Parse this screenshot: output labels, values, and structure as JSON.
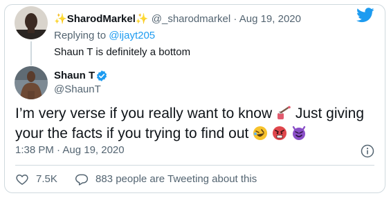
{
  "reply": {
    "name": "SharodMarkel",
    "sparkle": "✨",
    "handle": "@_sharodmarkel",
    "separator": "·",
    "date": "Aug 19, 2020",
    "replying_prefix": "Replying to",
    "replying_handle": "@ijayt205",
    "text": "Shaun T is definitely a bottom"
  },
  "tweet": {
    "name": "Shaun T",
    "handle": "@ShaunT",
    "text_part1": "I’m very verse if you really want to know",
    "text_part2": " Just giving your the facts if you trying to find out",
    "timestamp": "1:38 PM · Aug 19, 2020"
  },
  "footer": {
    "like_count": "7.5K",
    "tweeting_text": "883 people are Tweeting about this"
  },
  "icons": {
    "brand": "twitter-bird-icon",
    "verified": "verified-badge-icon",
    "info": "info-icon",
    "like": "heart-icon",
    "conversation": "speech-bubble-icon",
    "emoji_1": "nail-polish-emoji",
    "emoji_2": "rolling-laughing-emoji",
    "emoji_3": "angry-face-emoji",
    "emoji_4": "smiling-devil-emoji"
  },
  "colors": {
    "brand_blue": "#1d9bf0",
    "muted": "#536471",
    "text": "#0f1419",
    "border": "#cfd9de"
  }
}
